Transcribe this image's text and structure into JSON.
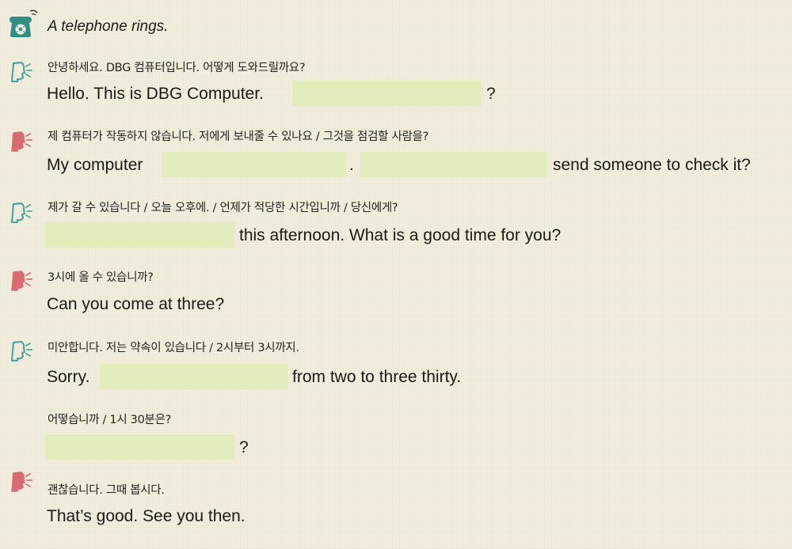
{
  "intro": {
    "icon": "telephone-icon",
    "text": "A telephone rings."
  },
  "lines": [
    {
      "speaker": "receptionist",
      "icon": "receptionist-speaking-icon",
      "korean": "안녕하세요. DBG 컴퓨터입니다. 어떻게 도와드릴까요?",
      "english": {
        "before": "Hello. This is DBG Computer.",
        "after": "?"
      }
    },
    {
      "speaker": "customer",
      "icon": "customer-speaking-icon",
      "korean": "제 컴퓨터가 작동하지 않습니다. 저에게 보내줄 수 있나요 / 그것을 점검할 사람을?",
      "english": {
        "before": "My computer",
        "middle": ".",
        "after": "send someone to check it?"
      }
    },
    {
      "speaker": "receptionist",
      "icon": "receptionist-speaking-icon",
      "korean": "제가 갈 수 있습니다 / 오늘 오후에. / 언제가 적당한 시간입니까 / 당신에게?",
      "english": {
        "after": "this afternoon. What is a good time for you?"
      }
    },
    {
      "speaker": "customer",
      "icon": "customer-speaking-icon",
      "korean": "3시에 올 수 있습니까?",
      "english": {
        "text": "Can you come at three?"
      }
    },
    {
      "speaker": "receptionist",
      "icon": "receptionist-speaking-icon",
      "korean": "미안합니다. 저는 약속이 있습니다 / 2시부터 3시까지.",
      "english": {
        "before": "Sorry.",
        "after": "from two to three thirty."
      }
    },
    {
      "speaker": "receptionist",
      "korean": "어떻습니까 / 1시 30분은?",
      "english": {
        "after": "?"
      }
    },
    {
      "speaker": "customer",
      "icon": "customer-speaking-icon",
      "korean": "괜찮습니다. 그때 봅시다.",
      "english": {
        "text": "That’s good. See you then."
      }
    }
  ],
  "colors": {
    "background": "#f3efdf",
    "blank_fill": "#e3edbb",
    "receptionist_icon": "#4ca7a0",
    "customer_icon": "#d96a72",
    "phone_icon": "#2f8f86"
  }
}
